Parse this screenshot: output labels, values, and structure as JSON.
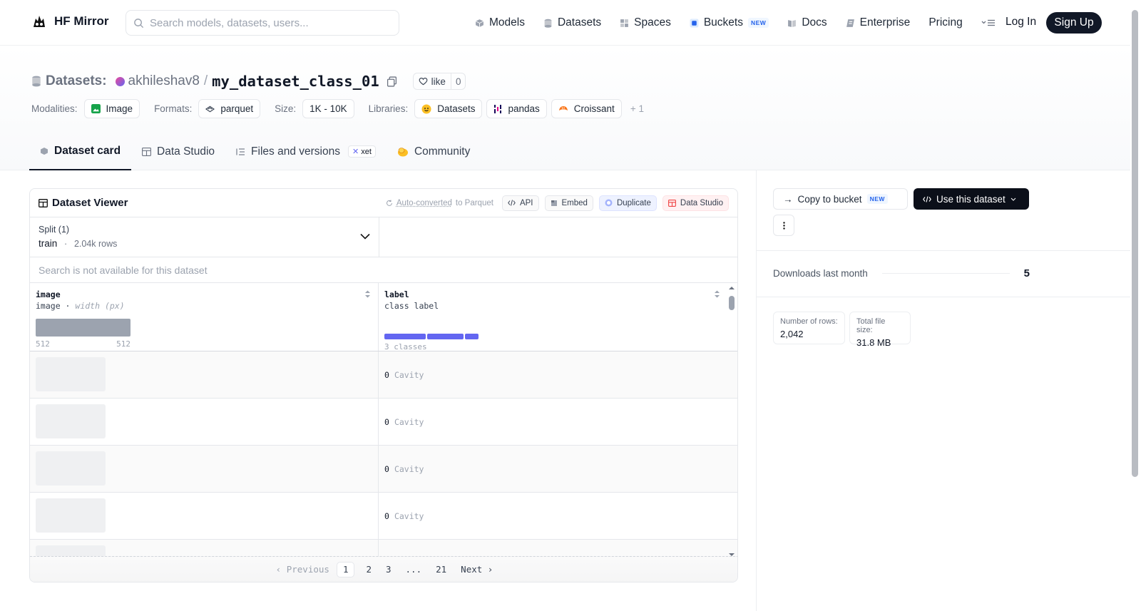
{
  "header": {
    "brand": "HF Mirror",
    "search_placeholder": "Search models, datasets, users...",
    "nav": [
      {
        "label": "Models",
        "icon": "models-icon"
      },
      {
        "label": "Datasets",
        "icon": "datasets-icon"
      },
      {
        "label": "Spaces",
        "icon": "spaces-icon"
      },
      {
        "label": "Buckets",
        "icon": "buckets-icon",
        "badge": "NEW"
      },
      {
        "label": "Docs",
        "icon": "docs-icon"
      },
      {
        "label": "Enterprise",
        "icon": "enterprise-icon"
      },
      {
        "label": "Pricing"
      }
    ],
    "login": "Log In",
    "signup": "Sign Up"
  },
  "repo": {
    "type_label": "Datasets:",
    "owner": "akhileshav8",
    "separator": "/",
    "name": "my_dataset_class_01",
    "like_label": "like",
    "like_count": "0"
  },
  "tags": {
    "modalities_label": "Modalities:",
    "modalities": [
      "Image"
    ],
    "formats_label": "Formats:",
    "formats": [
      "parquet"
    ],
    "size_label": "Size:",
    "size": [
      "1K - 10K"
    ],
    "libraries_label": "Libraries:",
    "libraries": [
      "Datasets",
      "pandas",
      "Croissant"
    ],
    "more": "+ 1"
  },
  "tabs": [
    {
      "label": "Dataset card",
      "active": true
    },
    {
      "label": "Data Studio"
    },
    {
      "label": "Files and versions",
      "badge": "xet"
    },
    {
      "label": "Community"
    }
  ],
  "viewer": {
    "title": "Dataset Viewer",
    "auto_link": "Auto-converted",
    "auto_rest": " to Parquet",
    "actions": [
      "API",
      "Embed",
      "Duplicate",
      "Data Studio"
    ],
    "split_label": "Split (1)",
    "split_value": "train",
    "split_dot": "·",
    "split_rows": "2.04k rows",
    "search_na": "Search is not available for this dataset",
    "columns": [
      {
        "name": "image",
        "type": "image",
        "type_sep": " · ",
        "type_extra": "width (px)",
        "min": "512",
        "max": "512"
      },
      {
        "name": "label",
        "type": "class label",
        "classes": "3 classes"
      }
    ],
    "rows": [
      {
        "label_id": "0",
        "label_name": "Cavity"
      },
      {
        "label_id": "0",
        "label_name": "Cavity"
      },
      {
        "label_id": "0",
        "label_name": "Cavity"
      },
      {
        "label_id": "0",
        "label_name": "Cavity"
      },
      {
        "label_id": "",
        "label_name": ""
      }
    ],
    "pager": {
      "prev": "Previous",
      "pages": [
        "1",
        "2",
        "3",
        "...",
        "21"
      ],
      "next": "Next"
    },
    "class_distribution": [
      0.45,
      0.4,
      0.15
    ]
  },
  "sidebar": {
    "copy_bucket": "Copy to bucket",
    "copy_badge": "NEW",
    "use_dataset": "Use this dataset",
    "downloads_label": "Downloads last month",
    "downloads_value": "5",
    "stats": [
      {
        "label": "Number of rows:",
        "value": "2,042"
      },
      {
        "label": "Total file size:",
        "value": "31.8 MB"
      }
    ]
  },
  "colors": {
    "accent": "#6366f1",
    "dark": "#0b0f19"
  }
}
